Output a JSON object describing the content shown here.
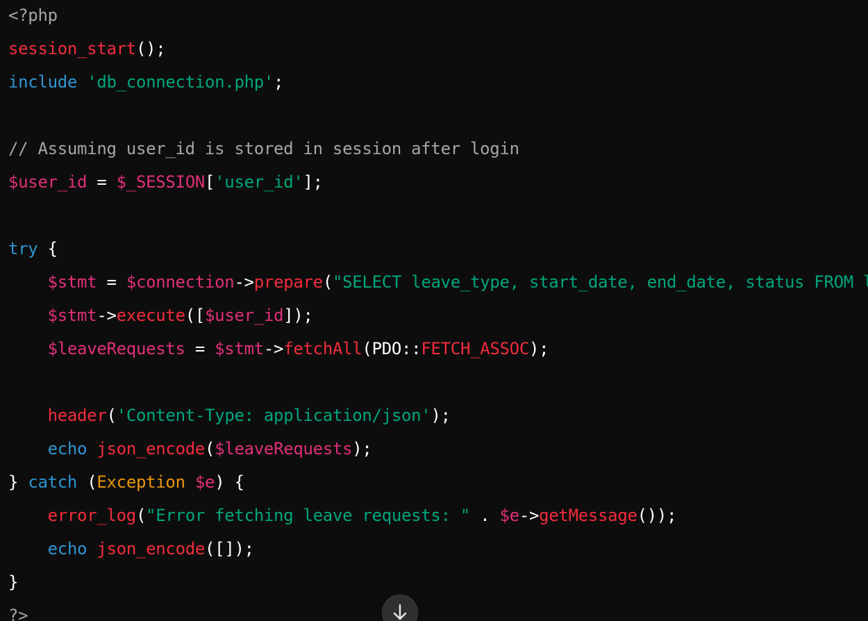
{
  "code": {
    "language": "php",
    "lines": [
      [
        {
          "t": "<?php",
          "c": "comment"
        }
      ],
      [
        {
          "t": "session_start",
          "c": "func"
        },
        {
          "t": "();",
          "c": "punct"
        }
      ],
      [
        {
          "t": "include",
          "c": "keyword"
        },
        {
          "t": " ",
          "c": "plain"
        },
        {
          "t": "'db_connection.php'",
          "c": "string"
        },
        {
          "t": ";",
          "c": "punct"
        }
      ],
      [],
      [
        {
          "t": "// Assuming user_id is stored in session after login",
          "c": "comment"
        }
      ],
      [
        {
          "t": "$user_id",
          "c": "var"
        },
        {
          "t": " = ",
          "c": "plain"
        },
        {
          "t": "$_SESSION",
          "c": "var"
        },
        {
          "t": "[",
          "c": "punct"
        },
        {
          "t": "'user_id'",
          "c": "string"
        },
        {
          "t": "];",
          "c": "punct"
        }
      ],
      [],
      [
        {
          "t": "try",
          "c": "keyword"
        },
        {
          "t": " {",
          "c": "punct"
        }
      ],
      [
        {
          "t": "    ",
          "c": "plain"
        },
        {
          "t": "$stmt",
          "c": "var"
        },
        {
          "t": " = ",
          "c": "plain"
        },
        {
          "t": "$connection",
          "c": "var"
        },
        {
          "t": "->",
          "c": "punct"
        },
        {
          "t": "prepare",
          "c": "func"
        },
        {
          "t": "(",
          "c": "punct"
        },
        {
          "t": "\"SELECT leave_type, start_date, end_date, status FROM leave_requests WHERE user_id = ?\"",
          "c": "string"
        },
        {
          "t": ");",
          "c": "punct"
        }
      ],
      [
        {
          "t": "    ",
          "c": "plain"
        },
        {
          "t": "$stmt",
          "c": "var"
        },
        {
          "t": "->",
          "c": "punct"
        },
        {
          "t": "execute",
          "c": "func"
        },
        {
          "t": "([",
          "c": "punct"
        },
        {
          "t": "$user_id",
          "c": "var"
        },
        {
          "t": "]);",
          "c": "punct"
        }
      ],
      [
        {
          "t": "    ",
          "c": "plain"
        },
        {
          "t": "$leaveRequests",
          "c": "var"
        },
        {
          "t": " = ",
          "c": "plain"
        },
        {
          "t": "$stmt",
          "c": "var"
        },
        {
          "t": "->",
          "c": "punct"
        },
        {
          "t": "fetchAll",
          "c": "func"
        },
        {
          "t": "(",
          "c": "punct"
        },
        {
          "t": "PDO",
          "c": "plain"
        },
        {
          "t": "::",
          "c": "plain"
        },
        {
          "t": "FETCH_ASSOC",
          "c": "func"
        },
        {
          "t": ");",
          "c": "punct"
        }
      ],
      [],
      [
        {
          "t": "    ",
          "c": "plain"
        },
        {
          "t": "header",
          "c": "func"
        },
        {
          "t": "(",
          "c": "punct"
        },
        {
          "t": "'Content-Type: application/json'",
          "c": "string"
        },
        {
          "t": ");",
          "c": "punct"
        }
      ],
      [
        {
          "t": "    ",
          "c": "plain"
        },
        {
          "t": "echo",
          "c": "keyword"
        },
        {
          "t": " ",
          "c": "plain"
        },
        {
          "t": "json_encode",
          "c": "func"
        },
        {
          "t": "(",
          "c": "punct"
        },
        {
          "t": "$leaveRequests",
          "c": "var"
        },
        {
          "t": ");",
          "c": "punct"
        }
      ],
      [
        {
          "t": "} ",
          "c": "punct"
        },
        {
          "t": "catch",
          "c": "keyword"
        },
        {
          "t": " (",
          "c": "punct"
        },
        {
          "t": "Exception",
          "c": "class"
        },
        {
          "t": " ",
          "c": "plain"
        },
        {
          "t": "$e",
          "c": "var"
        },
        {
          "t": ") {",
          "c": "punct"
        }
      ],
      [
        {
          "t": "    ",
          "c": "plain"
        },
        {
          "t": "error_log",
          "c": "func"
        },
        {
          "t": "(",
          "c": "punct"
        },
        {
          "t": "\"Error fetching leave requests: \"",
          "c": "string"
        },
        {
          "t": " . ",
          "c": "plain"
        },
        {
          "t": "$e",
          "c": "var"
        },
        {
          "t": "->",
          "c": "punct"
        },
        {
          "t": "getMessage",
          "c": "func"
        },
        {
          "t": "());",
          "c": "punct"
        }
      ],
      [
        {
          "t": "    ",
          "c": "plain"
        },
        {
          "t": "echo",
          "c": "keyword"
        },
        {
          "t": " ",
          "c": "plain"
        },
        {
          "t": "json_encode",
          "c": "func"
        },
        {
          "t": "([]);",
          "c": "punct"
        }
      ],
      [
        {
          "t": "}",
          "c": "punct"
        }
      ],
      [
        {
          "t": "?>",
          "c": "comment"
        }
      ]
    ]
  },
  "scroll_button": {
    "icon": "arrow-down-icon"
  },
  "colors": {
    "background": "#0d0d0d",
    "comment": "#a6a6a6",
    "string": "#00a67d",
    "keyword": "#2e95d3",
    "function": "#f22c3d",
    "variable": "#df3079",
    "class": "#e9950c",
    "plain": "#ffffff"
  }
}
